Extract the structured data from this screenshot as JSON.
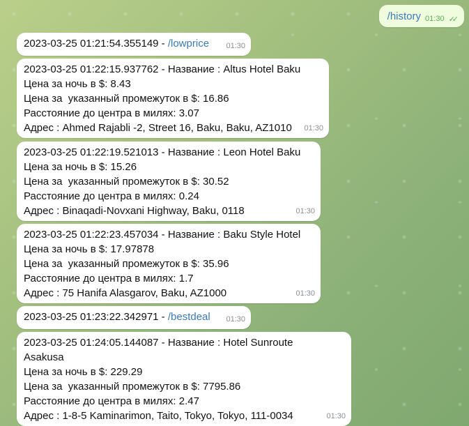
{
  "outgoing": {
    "command": "/history",
    "time": "01:30",
    "status": "read"
  },
  "messages": [
    {
      "ts": "2023-03-25 01:21:54.355149 - ",
      "cmd": "/lowprice",
      "time": "01:30"
    },
    {
      "lines": [
        "2023-03-25 01:22:15.937762 - Название : Altus Hotel Baku",
        "Цена за ночь в $: 8.43",
        "Цена за  указанный промежуток в $: 16.86",
        "Расстояние до центра в милях: 3.07",
        "Адрес : Ahmed Rajabli -2, Street 16, Baku, Baku, AZ1010"
      ],
      "time": "01:30"
    },
    {
      "lines": [
        "2023-03-25 01:22:19.521013 - Название : Leon Hotel Baku",
        "Цена за ночь в $: 15.26",
        "Цена за  указанный промежуток в $: 30.52",
        "Расстояние до центра в милях: 0.24",
        "Адрес : Binaqadi-Novxani Highway, Baku, 0118"
      ],
      "time": "01:30"
    },
    {
      "lines": [
        "2023-03-25 01:22:23.457034 - Название : Baku Style Hotel",
        "Цена за ночь в $: 17.97878",
        "Цена за  указанный промежуток в $: 35.96",
        "Расстояние до центра в милях: 1.7",
        "Адрес : 75 Hanifa Alasgarov, Baku, AZ1000"
      ],
      "time": "01:30"
    },
    {
      "ts": "2023-03-25 01:23:22.342971 - ",
      "cmd": "/bestdeal",
      "time": "01:30"
    },
    {
      "lines": [
        "2023-03-25 01:24:05.144087 - Название : Hotel Sunroute",
        "Asakusa",
        "Цена за ночь в $: 229.29",
        "Цена за  указанный промежуток в $: 7795.86",
        "Расстояние до центра в милях: 2.47",
        "Адрес : 1-8-5 Kaminarimon, Taito, Tokyo, Tokyo, 111-0034"
      ],
      "time": "01:30"
    }
  ]
}
